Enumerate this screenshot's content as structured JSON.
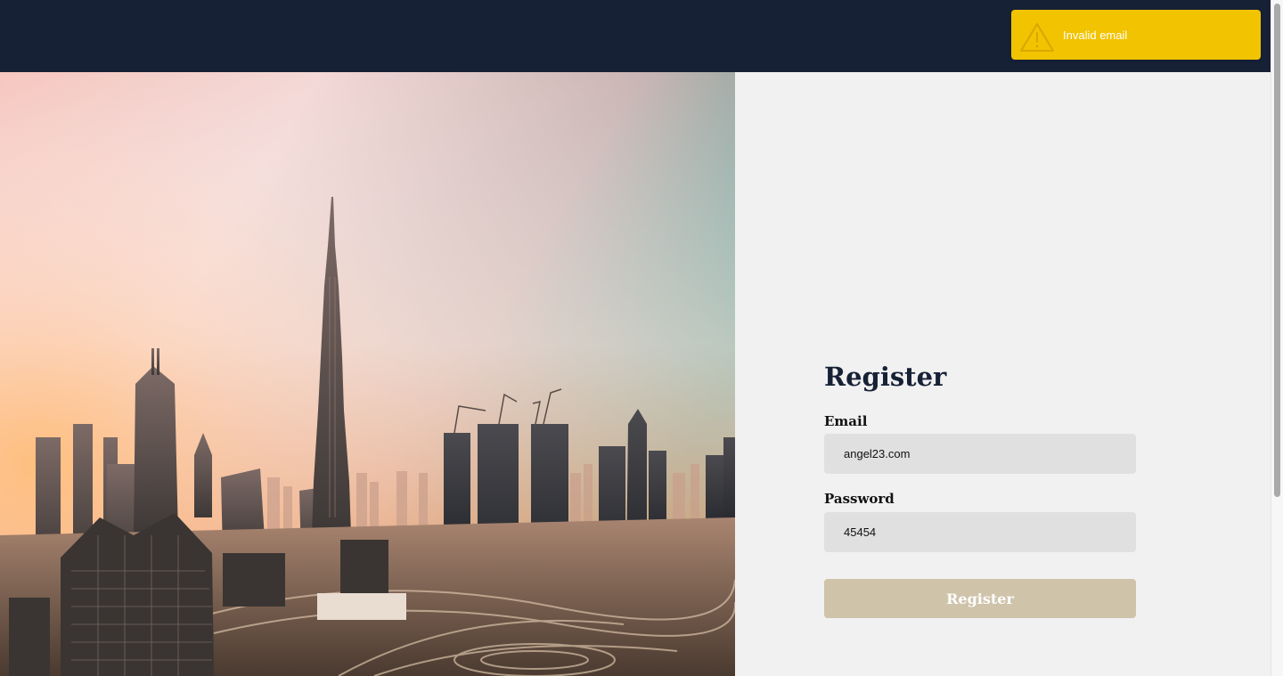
{
  "toast": {
    "message": "Invalid email",
    "icon": "warning-icon",
    "background": "#f2c300"
  },
  "hero": {
    "description_icon": "city-skyline-image"
  },
  "form": {
    "title": "Register",
    "email_label": "Email",
    "email_value": "angel23.com",
    "password_label": "Password",
    "password_value": "45454",
    "submit_label": "Register"
  },
  "colors": {
    "header": "#172136",
    "panel": "#f1f1f2",
    "input": "#e0e0e0",
    "button": "#cfc3aa",
    "title": "#172136"
  }
}
